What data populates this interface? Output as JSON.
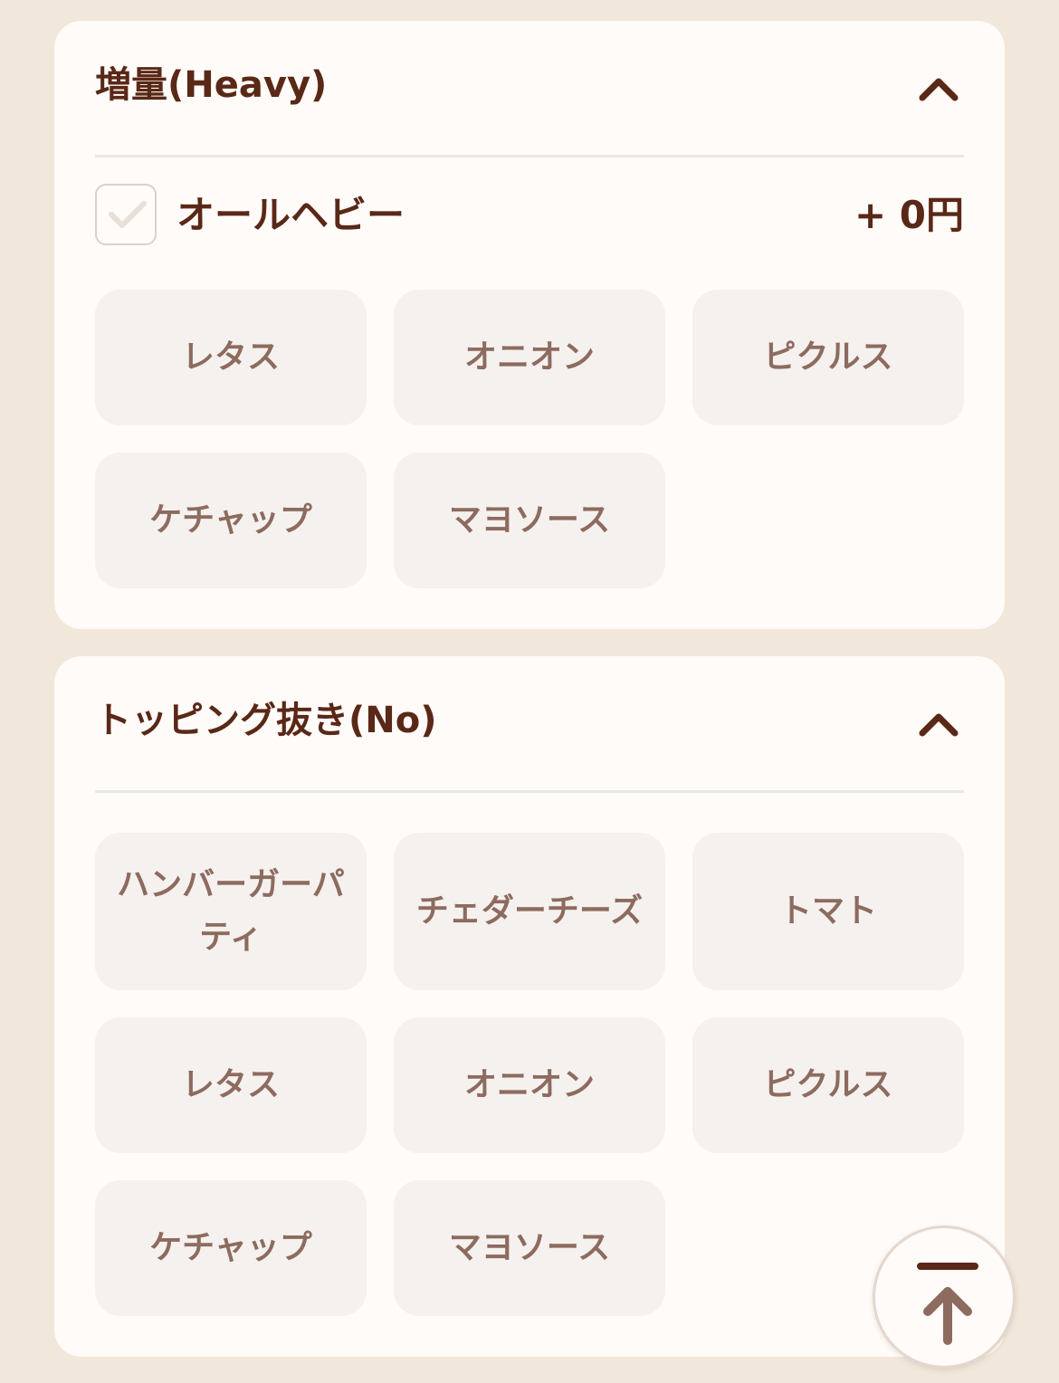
{
  "sections": [
    {
      "title": "増量(Heavy)",
      "all_option": {
        "label": "オールヘビー",
        "price": "+ 0円",
        "checked": false
      },
      "options": [
        "レタス",
        "オニオン",
        "ピクルス",
        "ケチャップ",
        "マヨソース"
      ]
    },
    {
      "title": "トッピング抜き(No)",
      "options": [
        "ハンバーガーパティ",
        "チェダーチーズ",
        "トマト",
        "レタス",
        "オニオン",
        "ピクルス",
        "ケチャップ",
        "マヨソース"
      ]
    }
  ],
  "icons": {
    "collapse": "chevron-up-icon",
    "check": "check-icon",
    "scroll_top": "arrow-up-to-line-icon"
  },
  "colors": {
    "background": "#f1e7da",
    "card": "#fffbf8",
    "title_text": "#5a2817",
    "option_bg": "#f5f1ee",
    "option_text": "#8d6b5f"
  }
}
